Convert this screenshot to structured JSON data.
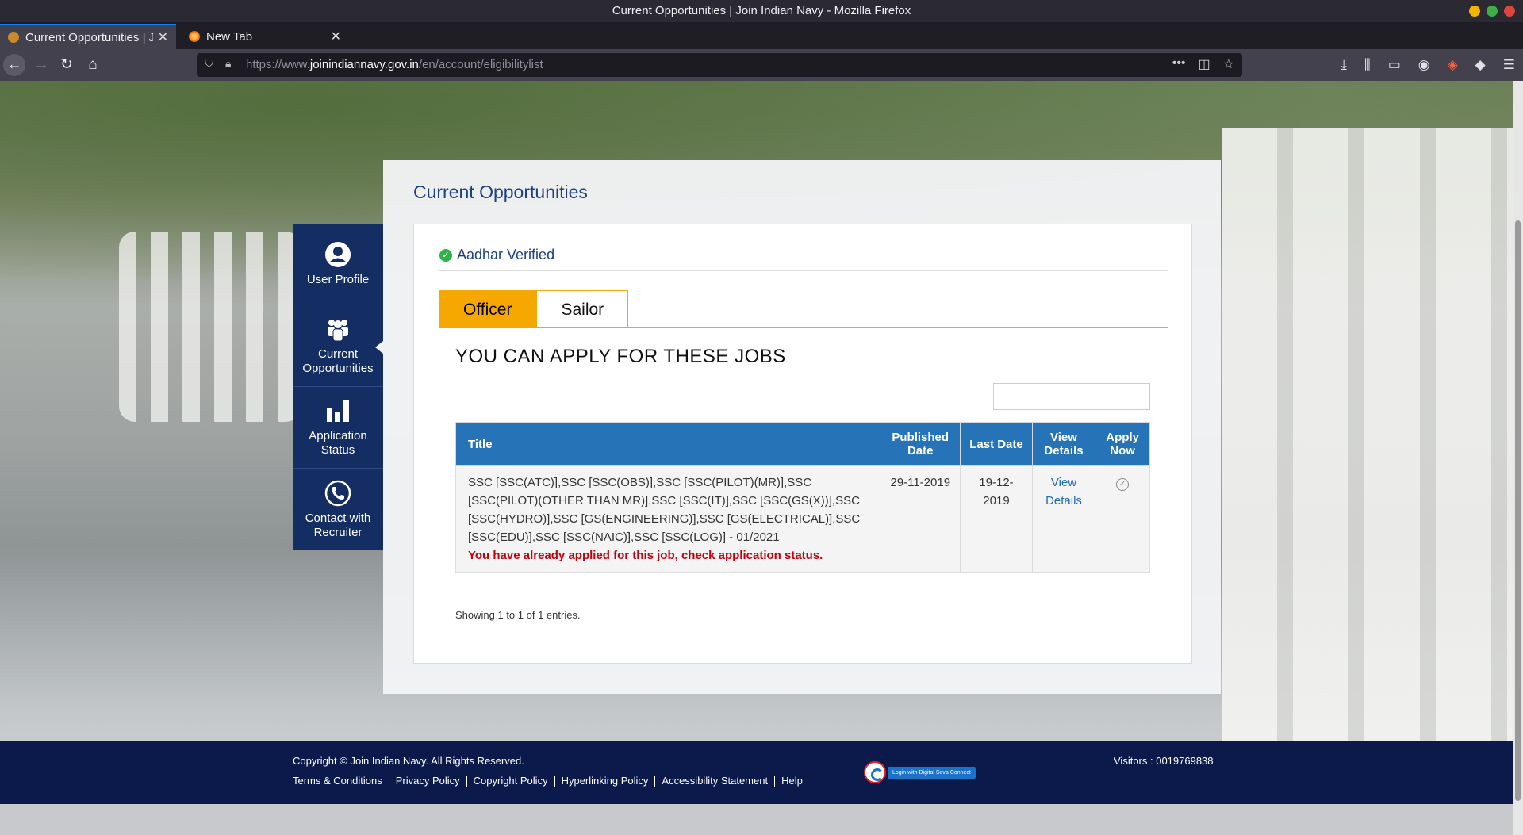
{
  "window": {
    "title": "Current Opportunities | Join Indian Navy - Mozilla Firefox"
  },
  "browser": {
    "tabs": [
      {
        "label": "Current Opportunities | Join Indian Navy",
        "active": true
      },
      {
        "label": "New Tab",
        "active": false
      }
    ],
    "url": {
      "prefix": "https://www.",
      "domain": "joinindiannavy.gov.in",
      "path": "/en/account/eligibilitylist"
    }
  },
  "sidebar": {
    "items": [
      {
        "label": "User Profile",
        "icon": "user-icon"
      },
      {
        "label": "Current Opportunities",
        "icon": "group-icon",
        "active": true
      },
      {
        "label": "Application Status",
        "icon": "bar-chart-icon"
      },
      {
        "label": "Contact with Recruiter",
        "icon": "phone-icon"
      }
    ]
  },
  "main": {
    "title": "Current Opportunities",
    "aadhar_status": "Aadhar Verified",
    "tabs": [
      {
        "label": "Officer",
        "active": true
      },
      {
        "label": "Sailor",
        "active": false
      }
    ],
    "section_heading": "YOU CAN APPLY FOR THESE JOBS",
    "search": {
      "value": "",
      "placeholder": ""
    },
    "table": {
      "headers": {
        "title": "Title",
        "published_date": "Published Date",
        "last_date": "Last Date",
        "view_details": "View Details",
        "apply_now": "Apply Now"
      },
      "rows": [
        {
          "title": "SSC [SSC(ATC)],SSC [SSC(OBS)],SSC [SSC(PILOT)(MR)],SSC [SSC(PILOT)(OTHER THAN MR)],SSC [SSC(IT)],SSC [SSC(GS(X))],SSC [SSC(HYDRO)],SSC [GS(ENGINEERING)],SSC [GS(ELECTRICAL)],SSC [SSC(EDU)],SSC [SSC(NAIC)],SSC [SSC(LOG)] - 01/2021",
          "notice": "You have already applied for this job, check application status.",
          "published_date": "29-11-2019",
          "last_date": "19-12-2019",
          "view_details": "View Details",
          "apply_icon": "check-circle-icon"
        }
      ]
    },
    "showing": "Showing 1 to 1 of 1 entries."
  },
  "footer": {
    "copyright": "Copyright © Join Indian Navy. All Rights Reserved.",
    "links": [
      "Terms & Conditions",
      "Privacy Policy",
      "Copyright Policy",
      "Hyperlinking Policy",
      "Accessibility Statement",
      "Help"
    ],
    "dsc_badge": "Login with Digital Seva Connect",
    "visitors": "Visitors : 0019769838"
  },
  "colors": {
    "navy": "#142d63",
    "accent_orange": "#f6a800",
    "table_header_blue": "#2673b8",
    "warning_red": "#c8000a",
    "footer_bg": "#0b1a4a"
  }
}
